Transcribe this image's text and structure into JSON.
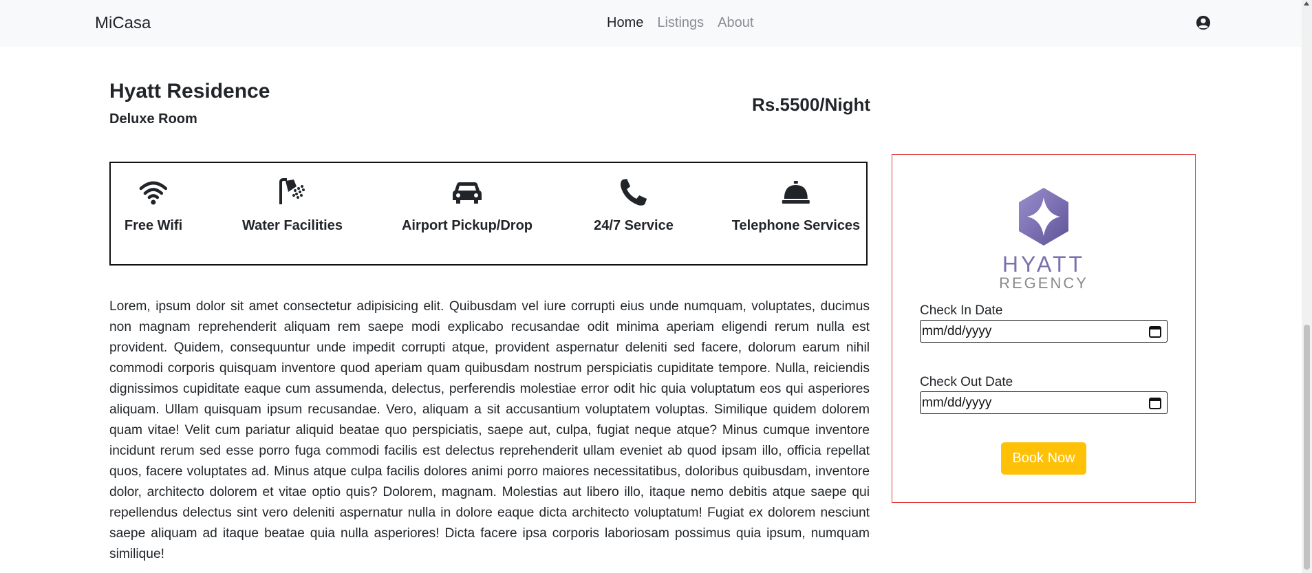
{
  "navbar": {
    "brand": "MiCasa",
    "links": [
      {
        "label": "Home",
        "active": true
      },
      {
        "label": "Listings",
        "active": false
      },
      {
        "label": "About",
        "active": false
      }
    ],
    "user_icon": "user-circle-icon"
  },
  "listing": {
    "name": "Hyatt Residence",
    "room_type": "Deluxe Room",
    "price": "Rs.5500/Night"
  },
  "amenities": [
    {
      "label": "Free Wifi",
      "icon": "wifi-icon"
    },
    {
      "label": "Water Facilities",
      "icon": "shower-icon"
    },
    {
      "label": "Airport Pickup/Drop",
      "icon": "car-icon"
    },
    {
      "label": "24/7 Service",
      "icon": "phone-icon"
    },
    {
      "label": "Telephone Services",
      "icon": "service-bell-icon"
    }
  ],
  "description": "Lorem, ipsum dolor sit amet consectetur adipisicing elit. Quibusdam vel iure corrupti eius unde numquam, voluptates, ducimus non magnam reprehenderit aliquam rem saepe modi explicabo recusandae odit minima aperiam eligendi rerum nulla est provident. Quidem, consequuntur unde impedit corrupti atque, provident aspernatur deleniti sed facere, dolorum earum nihil commodi corporis quisquam inventore quod aperiam quam quibusdam nostrum perspiciatis cupiditate tempore. Nulla, reiciendis dignissimos cupiditate eaque cum assumenda, delectus, perferendis molestiae error odit hic quia voluptatum eos qui asperiores aliquam. Ullam quisquam ipsum recusandae. Vero, aliquam a sit accusantium voluptatem voluptas. Similique quidem dolorem quam vitae! Velit cum pariatur aliquid beatae quo perspiciatis, saepe aut, culpa, fugiat neque atque? Minus cumque inventore incidunt rerum sed esse porro fuga commodi facilis est delectus reprehenderit ullam eveniet ab quod ipsam illo, officia repellat quos, facere voluptates ad. Minus atque culpa facilis dolores animi porro maiores necessitatibus, doloribus quibusdam, inventore dolor, architecto dolorem et vitae optio quis? Dolorem, magnam. Molestias aut libero illo, itaque nemo debitis atque saepe qui repellendus delectus sint vero deleniti aspernatur nulla in dolore eaque dicta architecto voluptatum! Fugiat ex dolorem nesciunt saepe aliquam ad itaque beatae quia nulla asperiores! Dicta facere ipsa corporis laboriosam possimus quia ipsum, numquam similique!",
  "booking": {
    "logo": {
      "line1": "HYATT",
      "line2": "REGENCY",
      "icon": "hyatt-logo"
    },
    "check_in_label": "Check In Date",
    "check_in_value": "mm/dd/yyyy",
    "check_out_label": "Check Out Date",
    "check_out_value": "mm/dd/yyyy",
    "button": "Book Now"
  },
  "colors": {
    "navbar_bg": "#f8f9fa",
    "button_bg": "#ffc107",
    "card_border": "#e03a3a",
    "logo_purple": "#7b6fb3"
  }
}
